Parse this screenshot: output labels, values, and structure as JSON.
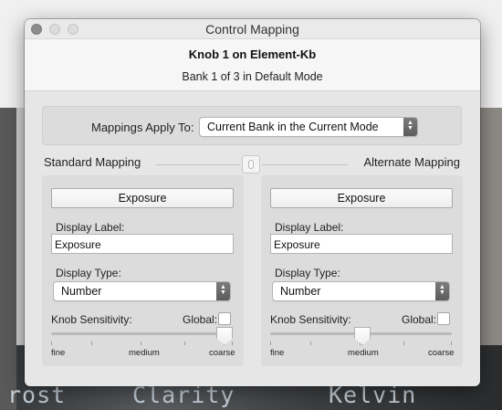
{
  "window": {
    "title": "Control Mapping"
  },
  "header": {
    "title": "Knob 1 on Element-Kb",
    "subtitle": "Bank 1 of 3 in Default Mode"
  },
  "apply": {
    "label": "Mappings Apply To:",
    "selected": "Current Bank in the Current Mode"
  },
  "columns": {
    "standard_title": "Standard Mapping",
    "alternate_title": "Alternate Mapping"
  },
  "standard": {
    "button_label": "Exposure",
    "display_label_caption": "Display Label:",
    "display_label_value": "Exposure",
    "display_type_caption": "Display Type:",
    "display_type_value": "Number",
    "sensitivity_caption": "Knob Sensitivity:",
    "global_caption": "Global:",
    "global_checked": false,
    "sensitivity_value": "coarse",
    "tick_labels": {
      "fine": "fine",
      "medium": "medium",
      "coarse": "coarse"
    }
  },
  "alternate": {
    "button_label": "Exposure",
    "display_label_caption": "Display Label:",
    "display_label_value": "Exposure",
    "display_type_caption": "Display Type:",
    "display_type_value": "Number",
    "sensitivity_caption": "Knob Sensitivity:",
    "global_caption": "Global:",
    "global_checked": false,
    "sensitivity_value": "medium",
    "tick_labels": {
      "fine": "fine",
      "medium": "medium",
      "coarse": "coarse"
    }
  },
  "background": {
    "words": [
      "rost",
      "Clarity",
      "Kelvin"
    ]
  },
  "colors": {
    "window_bg": "#e6e6e6",
    "panel_bg": "#dcdcdc",
    "select_button": "#6b6b6b"
  }
}
